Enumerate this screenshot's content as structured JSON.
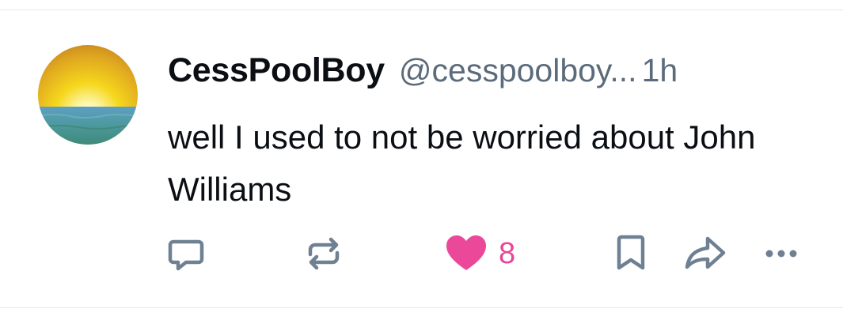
{
  "post": {
    "author": {
      "display_name": "CessPoolBoy",
      "handle": "@cesspoolboy...",
      "avatar": "sunset-over-sea-avatar"
    },
    "timestamp": "1h",
    "text": "well I used to not be worried about John Williams",
    "actions": {
      "reply_icon": "speech-bubble-icon",
      "repost_icon": "repost-arrows-icon",
      "like_icon": "heart-icon",
      "like_count": "8",
      "like_active": true,
      "bookmark_icon": "bookmark-icon",
      "share_icon": "share-arrow-icon",
      "more_icon": "ellipsis-icon"
    }
  },
  "colors": {
    "text_primary": "#0b0f14",
    "text_secondary": "#5b6b7c",
    "icon_gray": "#6f8093",
    "like_pink": "#ec4899",
    "divider": "#e6e9ed"
  }
}
